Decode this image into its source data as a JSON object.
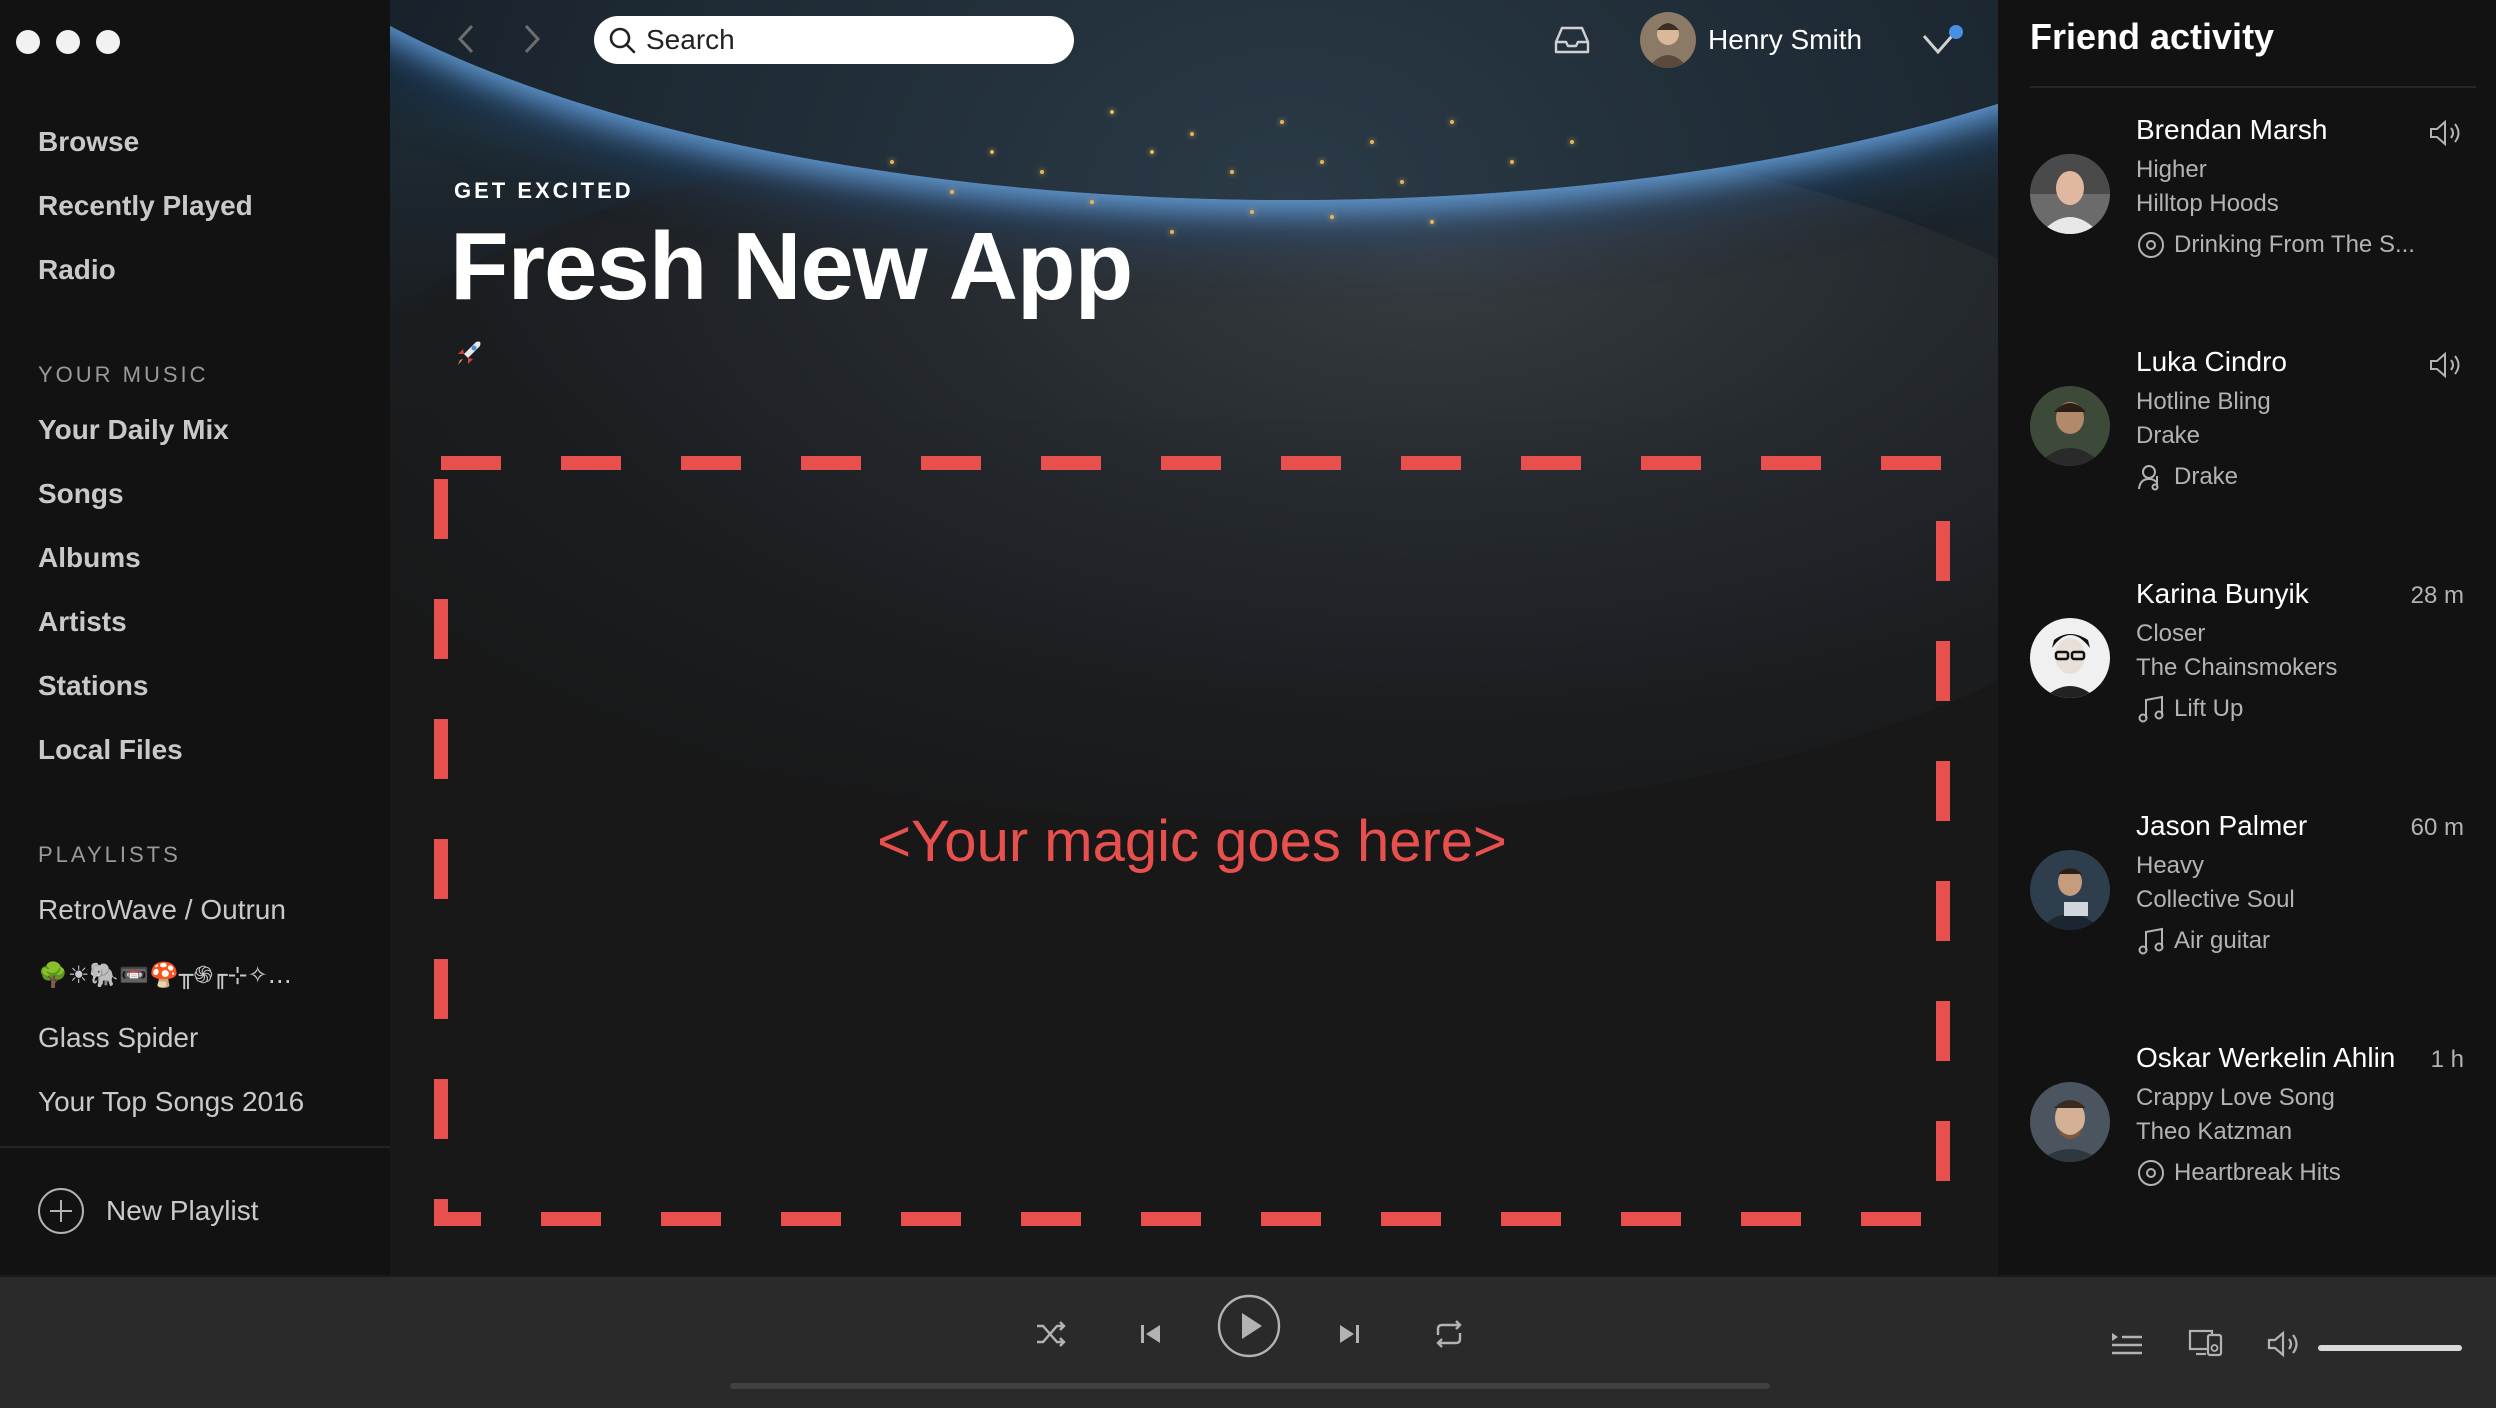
{
  "window": {
    "traffic_lights": [
      "close",
      "minimize",
      "zoom"
    ]
  },
  "sidebar": {
    "nav": [
      "Browse",
      "Recently Played",
      "Radio"
    ],
    "your_music_title": "YOUR MUSIC",
    "your_music": [
      "Your Daily Mix",
      "Songs",
      "Albums",
      "Artists",
      "Stations",
      "Local Files"
    ],
    "playlists_title": "PLAYLISTS",
    "playlists": [
      "RetroWave / Outrun",
      "🌳☀🐘📼🍄╥֍╓⊹✧…",
      "Glass Spider",
      "Your Top Songs 2016"
    ],
    "new_playlist": "New Playlist"
  },
  "topbar": {
    "search_placeholder": "Search",
    "user_name": "Henry Smith",
    "notification_color": "#4a90e2"
  },
  "hero": {
    "subtitle": "GET EXCITED",
    "title": "Fresh New App",
    "emoji": "rocket"
  },
  "main": {
    "placeholder_text": "<Your magic goes here>",
    "accent_color": "#e8504e"
  },
  "friends": {
    "title": "Friend activity",
    "items": [
      {
        "name": "Brendan Marsh",
        "song": "Higher",
        "artist": "Hilltop Hoods",
        "context": "Drinking From The S...",
        "context_icon": "album-icon",
        "time": "",
        "now_playing": true
      },
      {
        "name": "Luka Cindro",
        "song": "Hotline Bling",
        "artist": "Drake",
        "context": "Drake",
        "context_icon": "artist-icon",
        "time": "",
        "now_playing": true
      },
      {
        "name": "Karina Bunyik",
        "song": "Closer",
        "artist": "The Chainsmokers",
        "context": "Lift Up",
        "context_icon": "playlist-icon",
        "time": "28 m",
        "now_playing": false
      },
      {
        "name": "Jason Palmer",
        "song": "Heavy",
        "artist": "Collective Soul",
        "context": "Air guitar",
        "context_icon": "playlist-icon",
        "time": "60 m",
        "now_playing": false
      },
      {
        "name": "Oskar Werkelin Ahlin",
        "song": "Crappy Love Song",
        "artist": "Theo Katzman",
        "context": "Heartbreak Hits",
        "context_icon": "album-icon",
        "time": "1 h",
        "now_playing": false
      }
    ]
  },
  "player": {
    "progress": 0,
    "volume": 1.0
  }
}
